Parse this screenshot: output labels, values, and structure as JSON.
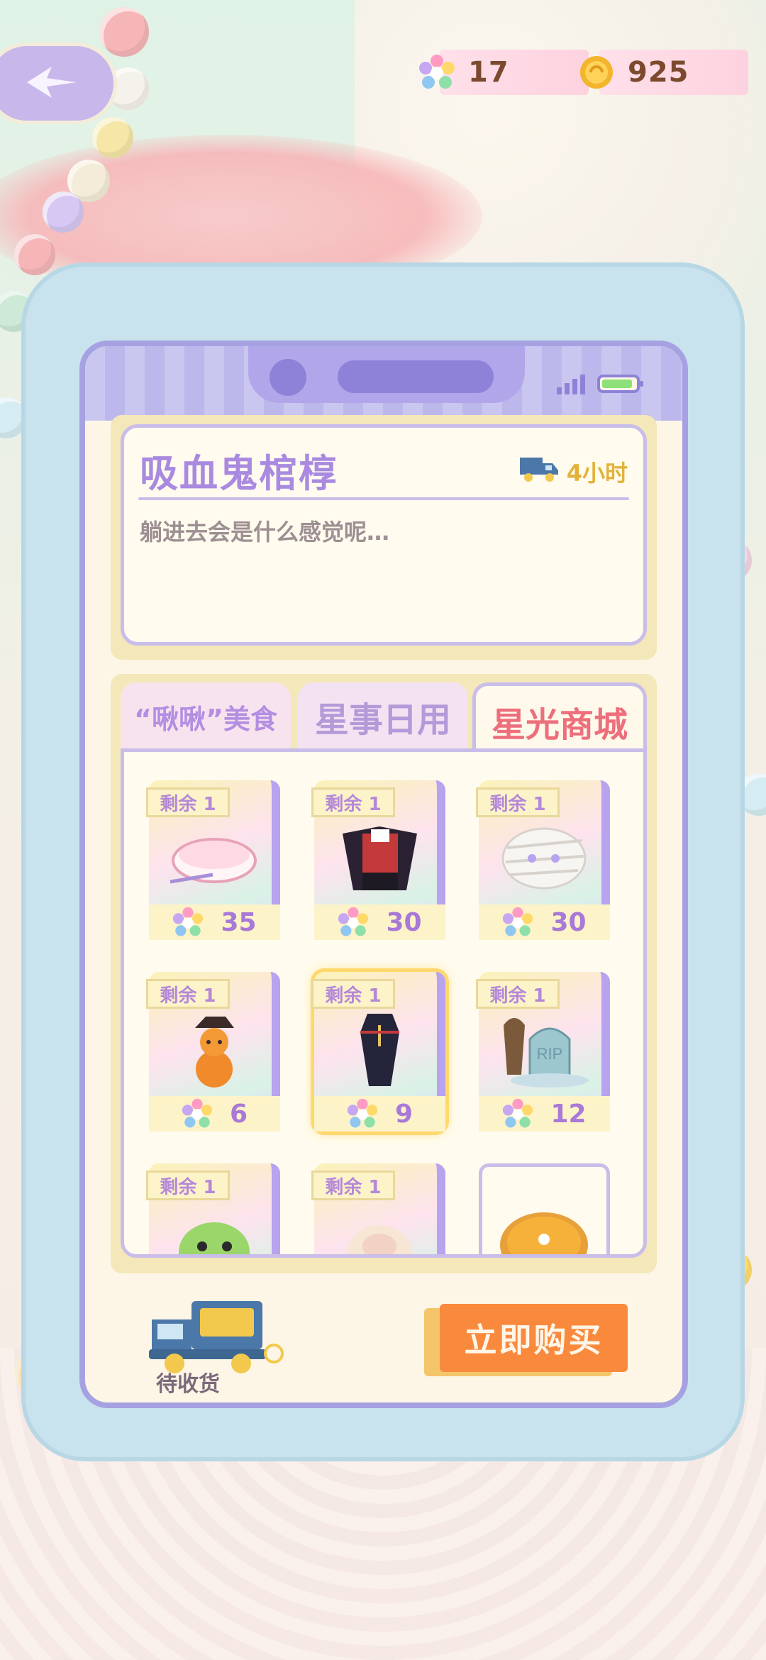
{
  "currencies": [
    {
      "icon": "rainbow-star-icon",
      "value": "17"
    },
    {
      "icon": "gold-coin-icon",
      "value": "925"
    }
  ],
  "item": {
    "title": "吸血鬼棺椁",
    "delivery_time": "4小时",
    "description": "躺进去会是什么感觉呢…"
  },
  "tabs": [
    {
      "label": "“啾啾”美食",
      "active": false
    },
    {
      "label": "星事日用",
      "active": false
    },
    {
      "label": "星光商城",
      "active": true
    }
  ],
  "products": [
    {
      "stock": "剩余 1",
      "price": "35",
      "art": "robot-vacuum"
    },
    {
      "stock": "剩余 1",
      "price": "30",
      "art": "vampire-outfit"
    },
    {
      "stock": "剩余 1",
      "price": "30",
      "art": "mummy-bandage"
    },
    {
      "stock": "剩余 1",
      "price": "6",
      "art": "pumpkin-snowman"
    },
    {
      "stock": "剩余 1",
      "price": "9",
      "art": "coffin",
      "selected": true
    },
    {
      "stock": "剩余 1",
      "price": "12",
      "art": "tombstone-rip",
      "label": "RIP"
    },
    {
      "stock": "剩余 1",
      "price": "",
      "art": "frog-plush"
    },
    {
      "stock": "剩余 1",
      "price": "",
      "art": "sheep-plush"
    },
    {
      "stock": "",
      "price": "",
      "art": "orange-pie"
    }
  ],
  "bottom": {
    "pending_label": "待收货",
    "buy_label": "立即购买"
  },
  "colors": {
    "accent_purple": "#a98ae0",
    "active_tab": "#ee6f7c",
    "buy_button": "#f98a3d",
    "frame": "#a6a2e2"
  }
}
